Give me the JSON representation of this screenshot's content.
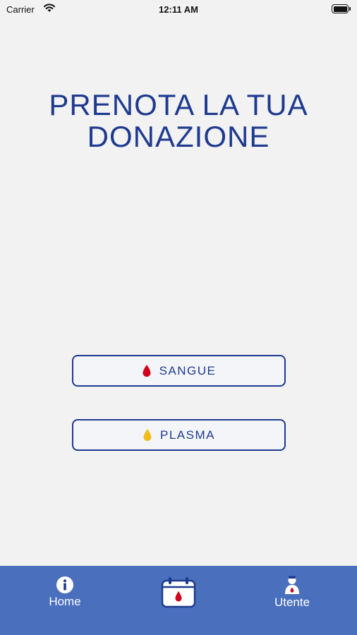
{
  "status_bar": {
    "carrier": "Carrier",
    "time": "12:11 AM"
  },
  "title": {
    "line1": "PRENOTA LA TUA",
    "line2": "DONAZIONE"
  },
  "buttons": {
    "blood": {
      "label": "SANGUE",
      "icon": "blood-drop-icon",
      "icon_color": "#d0021b"
    },
    "plasma": {
      "label": "PLASMA",
      "icon": "plasma-drop-icon",
      "icon_color": "#f2bb1d"
    }
  },
  "tab_bar": {
    "background": "#4a6fbd",
    "items": [
      {
        "label": "Home",
        "icon": "info-icon"
      },
      {
        "label": "",
        "icon": "calendar-blood-icon"
      },
      {
        "label": "Utente",
        "icon": "user-icon"
      }
    ]
  },
  "colors": {
    "background": "#f2f2f2",
    "accent": "#1e3a8f"
  }
}
